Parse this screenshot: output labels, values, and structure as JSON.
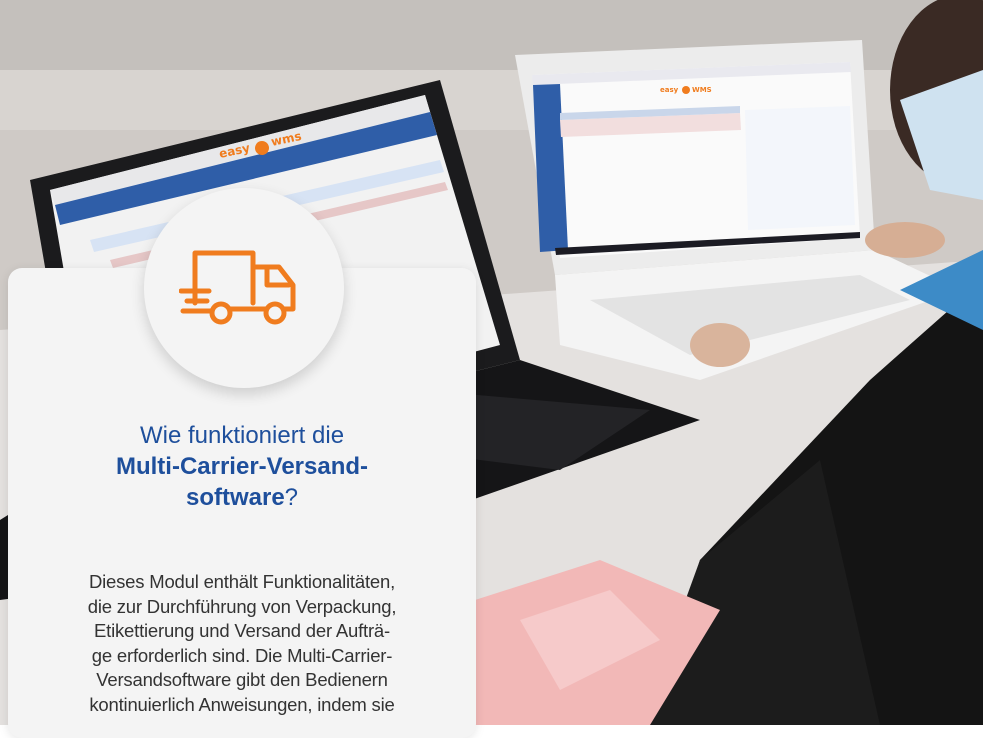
{
  "photo": {
    "brand_text": "easy wms"
  },
  "card": {
    "icon": "delivery-truck-icon",
    "accent_color": "#f07c1e",
    "title_color": "#1e4f9c",
    "heading": {
      "line1": "Wie funktioniert die",
      "line2": "Multi-Carrier-Versand-",
      "line3_bold": "software",
      "line3_rest": "?"
    },
    "paragraph_lines": [
      "Dieses Modul enthält Funktionalitäten,",
      "die zur Durchführung von Verpackung,",
      "Etikettierung und Versand der Aufträ-",
      "ge erforderlich sind. Die Multi-Carrier-",
      "Versandsoftware gibt den Bedienern",
      "kontinuierlich Anweisungen, indem sie"
    ]
  }
}
